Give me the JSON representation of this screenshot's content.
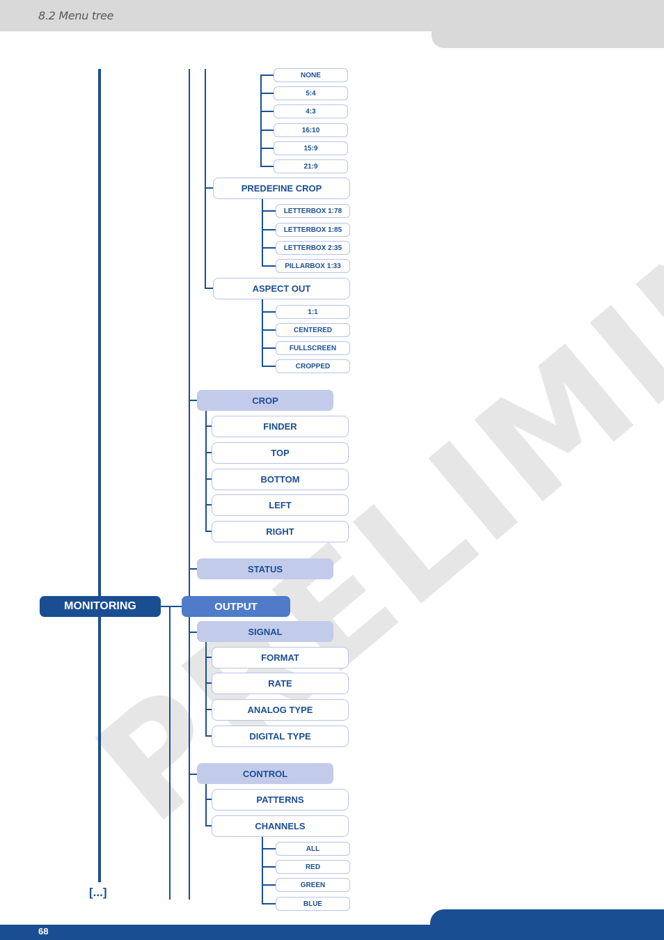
{
  "header": {
    "title": "8.2 Menu tree"
  },
  "footer": {
    "page_number": "68"
  },
  "watermark": "PRELIMINARY",
  "tree": {
    "aspect_in_options": [
      "NONE",
      "5:4",
      "4:3",
      "16:10",
      "15:9",
      "21:9"
    ],
    "predefine_crop": {
      "label": "PREDEFINE CROP",
      "options": [
        "LETTERBOX 1:78",
        "LETTERBOX 1:85",
        "LETTERBOX 2:35",
        "PILLARBOX 1:33"
      ]
    },
    "aspect_out": {
      "label": "ASPECT OUT",
      "options": [
        "1:1",
        "CENTERED",
        "FULLSCREEN",
        "CROPPED"
      ]
    },
    "crop": {
      "label": "CROP",
      "items": [
        "FINDER",
        "TOP",
        "BOTTOM",
        "LEFT",
        "RIGHT"
      ]
    },
    "status": {
      "label": "STATUS"
    },
    "monitoring": {
      "label": "MONITORING"
    },
    "output": {
      "label": "OUTPUT",
      "signal": {
        "label": "SIGNAL",
        "items": [
          "FORMAT",
          "RATE",
          "ANALOG TYPE",
          "DIGITAL TYPE"
        ]
      },
      "control": {
        "label": "CONTROL",
        "items": [
          "PATTERNS",
          "CHANNELS"
        ],
        "channels_options": [
          "ALL",
          "RED",
          "GREEN",
          "BLUE"
        ]
      }
    },
    "continuation": "[...]"
  }
}
